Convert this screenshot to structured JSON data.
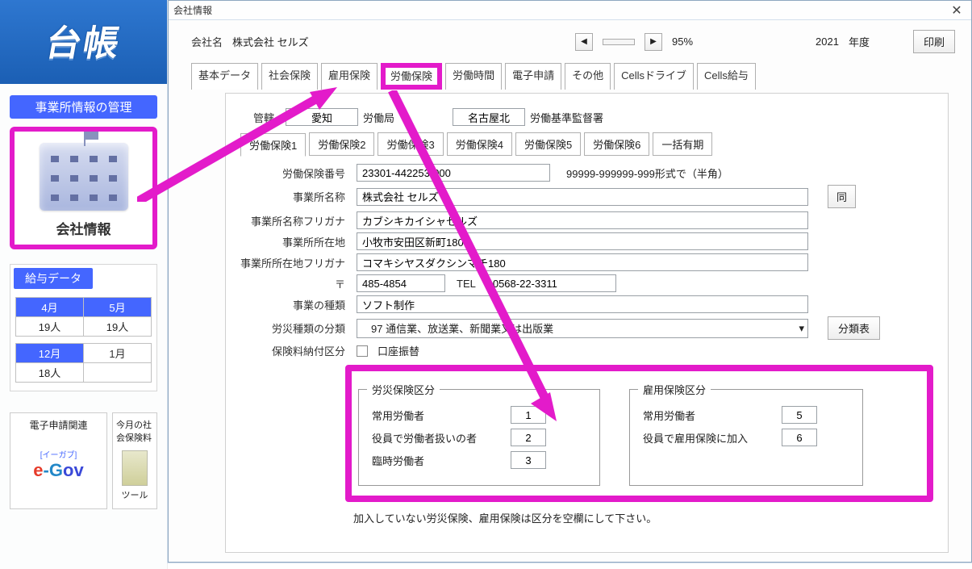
{
  "left": {
    "logo": "台帳",
    "mgmt_header": "事業所情報の管理",
    "company_label": "会社情報",
    "salary_title": "給与データ",
    "salary_cols": [
      "4月",
      "5月"
    ],
    "salary_row1": [
      "19人",
      "19人"
    ],
    "salary_cols2": [
      "12月",
      "1月"
    ],
    "salary_row2": [
      "18人",
      ""
    ],
    "box_left_title": "電子申請関連",
    "box_left_sub": "[イーガブ]",
    "box_right_title": "今月の社会保険料",
    "box_right_sub": "ツール"
  },
  "dialog": {
    "title": "会社情報",
    "company_label": "会社名",
    "company_name": "株式会社 セルズ",
    "zoom": "95%",
    "year": "2021",
    "year_suffix": "年度",
    "print": "印刷"
  },
  "tabs": [
    "基本データ",
    "社会保険",
    "雇用保険",
    "労働保険",
    "労働時間",
    "電子申請",
    "その他",
    "Cellsドライブ",
    "Cells給与"
  ],
  "subtabs": [
    "労働保険1",
    "労働保険2",
    "労働保険3",
    "労働保険4",
    "労働保険5",
    "労働保険6",
    "一括有期"
  ],
  "form": {
    "kankatsu_label": "管轄",
    "pref": "愛知",
    "roudoukyoku_label": "労働局",
    "office": "名古屋北",
    "kantoku_label": "労働基準監督署",
    "roudou_no_label": "労働保険番号",
    "roudou_no": "23301-442253-000",
    "roudou_no_hint": "99999-999999-999形式で（半角）",
    "jigyo_name_label": "事業所名称",
    "jigyo_name": "株式会社 セルズ",
    "jigyo_kana_label": "事業所名称フリガナ",
    "jigyo_kana": "カブシキカイシャセルズ",
    "addr_label": "事業所所在地",
    "addr": "小牧市安田区新町180",
    "addr_kana_label": "事業所所在地フリガナ",
    "addr_kana": "コマキシヤスダクシンマチ180",
    "zip_label": "〒",
    "zip": "485-4854",
    "tel_label": "TEL",
    "tel": "0568-22-3311",
    "biz_type_label": "事業の種類",
    "biz_type": "ソフト制作",
    "cls_label": "労災種類の分類",
    "cls_value": "　97 通信業、放送業、新聞業又は出版業",
    "cls_btn": "分類表",
    "pay_label": "保険料納付区分",
    "pay_cb_label": "口座振替",
    "same_btn": "同",
    "foot_note": "加入していない労災保険、雇用保険は区分を空欄にして下さい。"
  },
  "rosai": {
    "title": "労災保険区分",
    "r1": "常用労働者",
    "v1": "1",
    "r2": "役員で労働者扱いの者",
    "v2": "2",
    "r3": "臨時労働者",
    "v3": "3"
  },
  "koyo": {
    "title": "雇用保険区分",
    "r1": "常用労働者",
    "v1": "5",
    "r2": "役員で雇用保険に加入",
    "v2": "6"
  }
}
